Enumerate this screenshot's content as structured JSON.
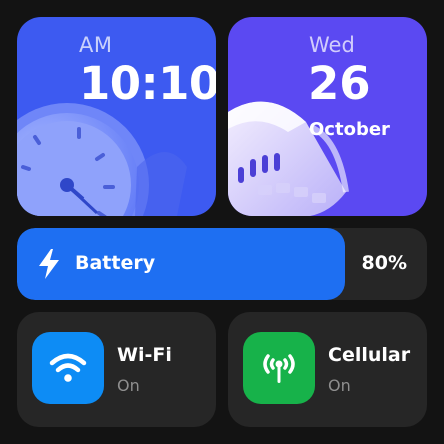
{
  "clock": {
    "period": "AM",
    "time": "10:10",
    "illustration": "alarm-clock-icon"
  },
  "date": {
    "weekday": "Wed",
    "day": "26",
    "month": "October",
    "illustration": "calendar-icon"
  },
  "battery": {
    "label": "Battery",
    "percent_text": "80%",
    "level": 0.8,
    "icon": "lightning-bolt-icon",
    "color": "#1e6ff2"
  },
  "toggles": [
    {
      "name": "Wi-Fi",
      "state": "On",
      "icon": "wifi-icon",
      "color": "#0d8cf5"
    },
    {
      "name": "Cellular",
      "state": "On",
      "icon": "cellular-antenna-icon",
      "color": "#17b24a"
    }
  ]
}
